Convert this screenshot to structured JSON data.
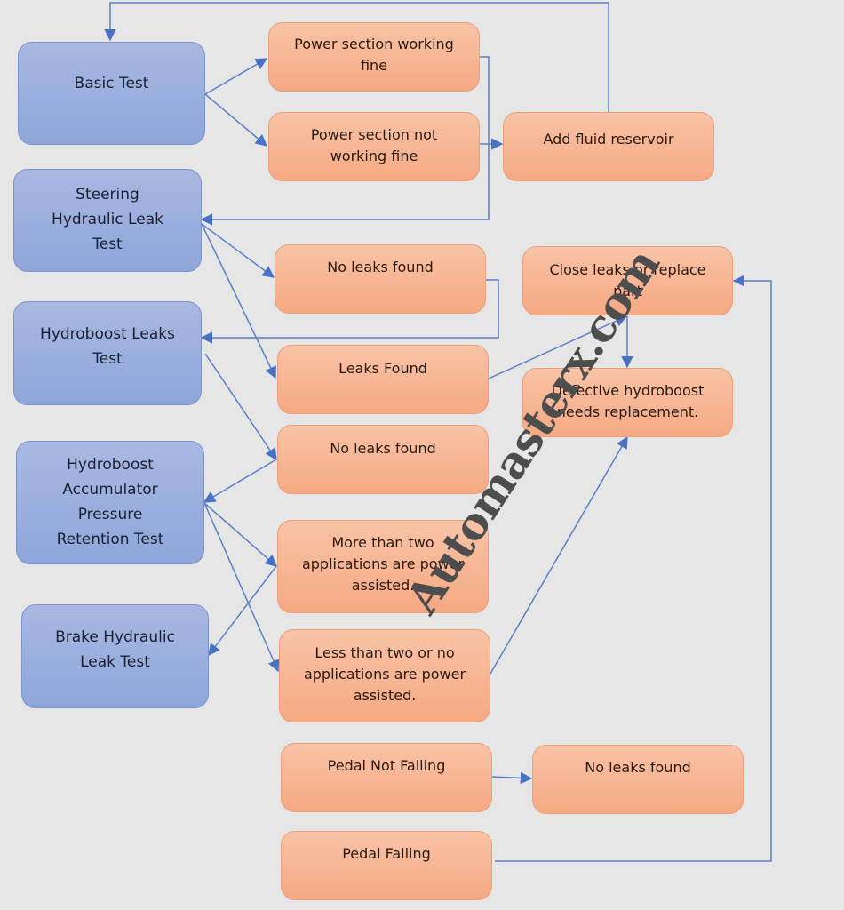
{
  "diagram": {
    "colors": {
      "background": "#e6e6e6",
      "test_node_fill": "#9cb0de",
      "result_node_fill": "#f7b592",
      "connector": "#4a72c4"
    },
    "test_nodes": [
      {
        "id": "basic-test",
        "lines": [
          "Basic Test"
        ]
      },
      {
        "id": "steering-hydraulic-leak-test",
        "lines": [
          "Steering",
          "Hydraulic Leak",
          "Test"
        ]
      },
      {
        "id": "hydroboost-leaks-test",
        "lines": [
          "Hydroboost Leaks",
          "Test"
        ]
      },
      {
        "id": "hydroboost-accumulator-test",
        "lines": [
          "Hydroboost",
          "Accumulator",
          "Pressure",
          "Retention Test"
        ]
      },
      {
        "id": "brake-hydraulic-leak-test",
        "lines": [
          "Brake Hydraulic",
          "Leak Test"
        ]
      }
    ],
    "result_nodes": [
      {
        "id": "power-working-fine",
        "lines": [
          "Power section working",
          "fine"
        ]
      },
      {
        "id": "power-not-working-fine",
        "lines": [
          "Power section not",
          "working fine"
        ]
      },
      {
        "id": "add-fluid-reservoir",
        "lines": [
          "Add fluid reservoir"
        ]
      },
      {
        "id": "no-leaks-found-1",
        "lines": [
          "No leaks found"
        ]
      },
      {
        "id": "close-leaks-replace-part",
        "lines": [
          "Close leaks or replace",
          "part"
        ]
      },
      {
        "id": "leaks-found",
        "lines": [
          "Leaks Found"
        ]
      },
      {
        "id": "defective-hydroboost",
        "lines": [
          "Defective hydroboost",
          "needs replacement."
        ]
      },
      {
        "id": "no-leaks-found-2",
        "lines": [
          "No leaks found"
        ]
      },
      {
        "id": "more-than-two",
        "lines": [
          "More than two",
          "applications are power",
          "assisted."
        ]
      },
      {
        "id": "less-than-two",
        "lines": [
          "Less than two or no",
          "applications are power",
          "assisted."
        ]
      },
      {
        "id": "pedal-not-falling",
        "lines": [
          "Pedal Not Falling"
        ]
      },
      {
        "id": "no-leaks-found-3",
        "lines": [
          "No leaks found"
        ]
      },
      {
        "id": "pedal-falling",
        "lines": [
          "Pedal Falling"
        ]
      }
    ],
    "edges": [
      {
        "from": "basic-test",
        "to": "power-working-fine"
      },
      {
        "from": "basic-test",
        "to": "power-not-working-fine"
      },
      {
        "from": "power-not-working-fine",
        "to": "add-fluid-reservoir"
      },
      {
        "from": "add-fluid-reservoir",
        "to": "basic-test"
      },
      {
        "from": "power-working-fine",
        "to": "steering-hydraulic-leak-test"
      },
      {
        "from": "steering-hydraulic-leak-test",
        "to": "no-leaks-found-1"
      },
      {
        "from": "steering-hydraulic-leak-test",
        "to": "leaks-found"
      },
      {
        "from": "no-leaks-found-1",
        "to": "hydroboost-leaks-test"
      },
      {
        "from": "leaks-found",
        "to": "close-leaks-replace-part"
      },
      {
        "from": "close-leaks-replace-part",
        "to": "defective-hydroboost"
      },
      {
        "from": "hydroboost-leaks-test",
        "to": "no-leaks-found-2"
      },
      {
        "from": "no-leaks-found-2",
        "to": "hydroboost-accumulator-test"
      },
      {
        "from": "hydroboost-accumulator-test",
        "to": "more-than-two"
      },
      {
        "from": "hydroboost-accumulator-test",
        "to": "less-than-two"
      },
      {
        "from": "more-than-two",
        "to": "brake-hydraulic-leak-test"
      },
      {
        "from": "less-than-two",
        "to": "defective-hydroboost"
      },
      {
        "from": "pedal-not-falling",
        "to": "no-leaks-found-3"
      },
      {
        "from": "pedal-falling",
        "to": "close-leaks-replace-part"
      }
    ],
    "watermark": "Automasterx.com"
  }
}
